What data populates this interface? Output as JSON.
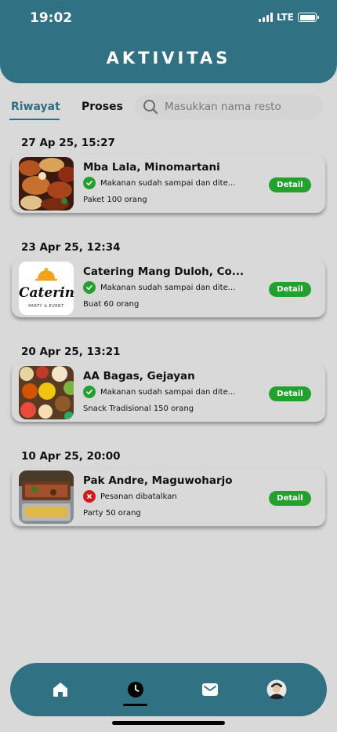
{
  "status_bar": {
    "time": "19:02",
    "network": "LTE"
  },
  "header": {
    "title": "AKTIVITAS"
  },
  "tabs": [
    {
      "label": "Riwayat",
      "active": true
    },
    {
      "label": "Proses",
      "active": false
    }
  ],
  "search": {
    "placeholder": "Masukkan nama resto"
  },
  "orders": [
    {
      "date": "27 Ap 25, 15:27",
      "resto": "Mba Lala, Minomartani",
      "status": "Makanan sudah sampai dan dite...",
      "status_type": "success",
      "description": "Paket 100 orang",
      "action": "Detail"
    },
    {
      "date": "23 Apr 25, 12:34",
      "resto": "Catering Mang Duloh, Co...",
      "status": "Makanan sudah sampai dan dite...",
      "status_type": "success",
      "description": "Buat 60 orang",
      "action": "Detail",
      "logo_text": "Catering",
      "logo_subtext": "PARTY & EVENT"
    },
    {
      "date": "20 Apr 25, 13:21",
      "resto": "AA Bagas, Gejayan",
      "status": "Makanan sudah sampai dan dite...",
      "status_type": "success",
      "description": "Snack Tradisional 150 orang",
      "action": "Detail"
    },
    {
      "date": "10 Apr 25, 20:00",
      "resto": "Pak Andre, Maguwoharjo",
      "status": "Pesanan dibatalkan",
      "status_type": "cancelled",
      "description": "Party 50 orang",
      "action": "Detail"
    }
  ],
  "bottom_nav": {
    "items": [
      "home-icon",
      "clock-icon",
      "mail-icon",
      "profile-avatar"
    ],
    "active": "clock-icon"
  },
  "colors": {
    "primary": "#317184",
    "background": "#d9d9d9",
    "success": "#23a12e",
    "cancel": "#d21a1a"
  }
}
